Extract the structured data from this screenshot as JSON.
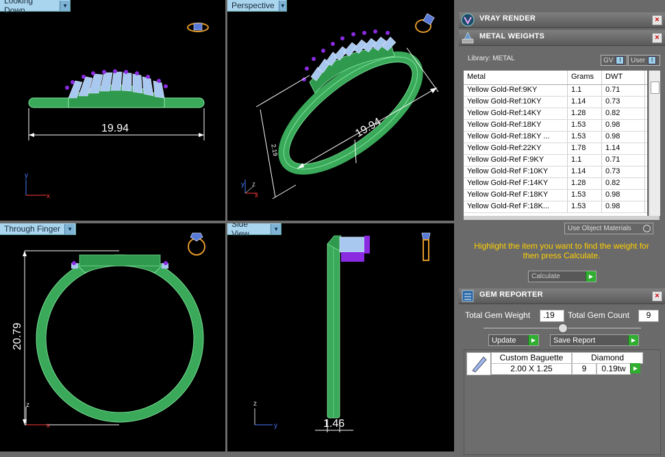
{
  "viewports": {
    "top_left": {
      "label": "Looking Down",
      "dimension": "19.94"
    },
    "top_right": {
      "label": "Perspective",
      "dimension": "19.94",
      "dimension_small": "2.19"
    },
    "bottom_left": {
      "label": "Through Finger",
      "dimension": "20.79"
    },
    "bottom_right": {
      "label": "Side View",
      "dimension": "1.46"
    }
  },
  "vray_panel": {
    "title": "VRAY RENDER"
  },
  "metal_panel": {
    "title": "METAL WEIGHTS",
    "library_label": "Library: METAL",
    "toggle_gv": "GV",
    "toggle_user": "User",
    "columns": [
      "Metal",
      "Grams",
      "DWT"
    ],
    "rows": [
      [
        "Yellow Gold-Ref:9KY",
        "1.1",
        "0.71"
      ],
      [
        "Yellow Gold-Ref:10KY",
        "1.14",
        "0.73"
      ],
      [
        "Yellow Gold-Ref:14KY",
        "1.28",
        "0.82"
      ],
      [
        "Yellow Gold-Ref:18KY",
        "1.53",
        "0.98"
      ],
      [
        "Yellow Gold-Ref:18KY ...",
        "1.53",
        "0.98"
      ],
      [
        "Yellow Gold-Ref:22KY",
        "1.78",
        "1.14"
      ],
      [
        "Yellow Gold-Ref F:9KY",
        "1.1",
        "0.71"
      ],
      [
        "Yellow Gold-Ref F:10KY",
        "1.14",
        "0.73"
      ],
      [
        "Yellow Gold-Ref F:14KY",
        "1.28",
        "0.82"
      ],
      [
        "Yellow Gold-Ref F:18KY",
        "1.53",
        "0.98"
      ],
      [
        "Yellow Gold-Ref F:18K...",
        "1.53",
        "0.98"
      ]
    ],
    "use_object_materials": "Use Object Materials",
    "hint": "Highlight the item you want to find the weight for then press Calculate.",
    "calculate": "Calculate"
  },
  "gem_panel": {
    "title": "GEM REPORTER",
    "total_weight_label": "Total Gem Weight",
    "total_weight_value": ".19",
    "total_count_label": "Total Gem Count",
    "total_count_value": "9",
    "update": "Update",
    "save_report": "Save Report",
    "gem": {
      "cut": "Custom Baguette",
      "type": "Diamond",
      "size": "2.00 X 1.25",
      "count": "9",
      "weight": "0.19tw"
    }
  },
  "colors": {
    "ring_green": "#3aa95a",
    "gem_blue": "#a9c8f0",
    "prong_purple": "#8a2be2",
    "hint_yellow": "#ffd000"
  }
}
